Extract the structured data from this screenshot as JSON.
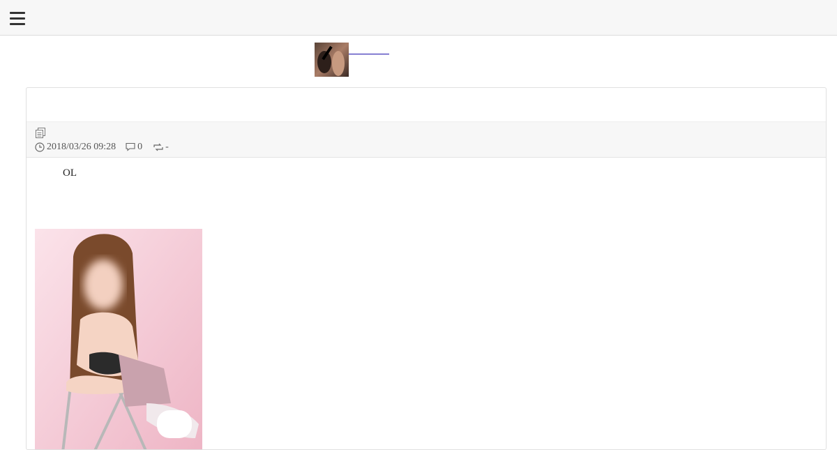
{
  "header": {
    "menu_icon": "hamburger-menu-icon"
  },
  "banner": {
    "thumbnail_icon": "banner-thumbnail",
    "link_text": ""
  },
  "article": {
    "category_icon": "document-icon",
    "date_icon": "clock-icon",
    "date": "2018/03/26 09:28",
    "comment_icon": "comment-icon",
    "comments": "0",
    "retweet_icon": "retweet-icon",
    "retweets": "-",
    "body": "OL",
    "photo": "article-photo"
  },
  "colors": {
    "topbar_bg": "#f7f7f7",
    "meta_bg": "#f7f7f7",
    "link": "#1a0dab",
    "photo_bg": "#f4c9d6"
  }
}
